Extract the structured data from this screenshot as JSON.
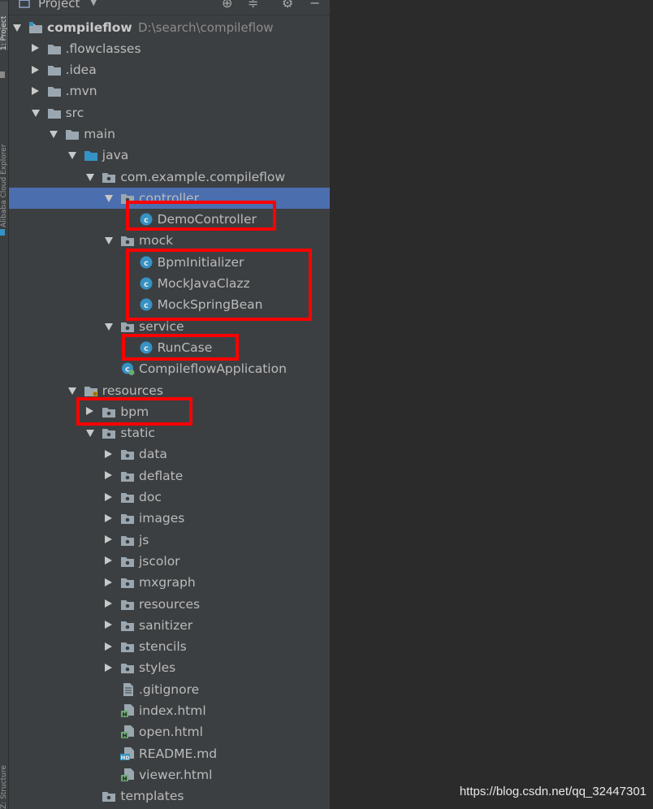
{
  "panel": {
    "title": "Project",
    "toolbar_icons": [
      "crosshair-icon",
      "collapse-icon",
      "gear-icon",
      "minimize-icon"
    ]
  },
  "side_tabs": {
    "project": "1: Project",
    "cloud": "Alibaba Cloud Explorer",
    "structure": "Z: Structure"
  },
  "colors": {
    "background": "#2b2b2b",
    "panel": "#3c3f41",
    "selection": "#4b6eaf",
    "highlight_box": "#ff0000",
    "java_class": "#3592c4"
  },
  "tree": [
    {
      "label": "compileflow",
      "path": "D:\\search\\compileflow",
      "level": 0,
      "expanded": true,
      "icon": "module-folder-icon",
      "bold": true
    },
    {
      "label": ".flowclasses",
      "level": 1,
      "expanded": false,
      "icon": "folder-icon"
    },
    {
      "label": ".idea",
      "level": 1,
      "expanded": false,
      "icon": "folder-icon"
    },
    {
      "label": ".mvn",
      "level": 1,
      "expanded": false,
      "icon": "folder-icon"
    },
    {
      "label": "src",
      "level": 1,
      "expanded": true,
      "icon": "folder-icon"
    },
    {
      "label": "main",
      "level": 2,
      "expanded": true,
      "icon": "folder-icon"
    },
    {
      "label": "java",
      "level": 3,
      "expanded": true,
      "icon": "source-folder-icon"
    },
    {
      "label": "com.example.compileflow",
      "level": 4,
      "expanded": true,
      "icon": "package-icon"
    },
    {
      "label": "controller",
      "level": 5,
      "expanded": true,
      "icon": "package-icon",
      "selected": true
    },
    {
      "label": "DemoController",
      "level": 6,
      "icon": "java-class-icon"
    },
    {
      "label": "mock",
      "level": 5,
      "expanded": true,
      "icon": "package-icon"
    },
    {
      "label": "BpmInitializer",
      "level": 6,
      "icon": "java-class-icon"
    },
    {
      "label": "MockJavaClazz",
      "level": 6,
      "icon": "java-class-icon"
    },
    {
      "label": "MockSpringBean",
      "level": 6,
      "icon": "java-class-icon"
    },
    {
      "label": "service",
      "level": 5,
      "expanded": true,
      "icon": "package-icon"
    },
    {
      "label": "RunCase",
      "level": 6,
      "icon": "java-class-icon"
    },
    {
      "label": "CompileflowApplication",
      "level": 5,
      "icon": "spring-boot-class-icon"
    },
    {
      "label": "resources",
      "level": 3,
      "expanded": true,
      "icon": "resources-folder-icon"
    },
    {
      "label": "bpm",
      "level": 4,
      "expanded": false,
      "icon": "package-icon"
    },
    {
      "label": "static",
      "level": 4,
      "expanded": true,
      "icon": "package-icon"
    },
    {
      "label": "data",
      "level": 5,
      "expanded": false,
      "icon": "package-icon"
    },
    {
      "label": "deflate",
      "level": 5,
      "expanded": false,
      "icon": "package-icon"
    },
    {
      "label": "doc",
      "level": 5,
      "expanded": false,
      "icon": "package-icon"
    },
    {
      "label": "images",
      "level": 5,
      "expanded": false,
      "icon": "package-icon"
    },
    {
      "label": "js",
      "level": 5,
      "expanded": false,
      "icon": "package-icon"
    },
    {
      "label": "jscolor",
      "level": 5,
      "expanded": false,
      "icon": "package-icon"
    },
    {
      "label": "mxgraph",
      "level": 5,
      "expanded": false,
      "icon": "package-icon"
    },
    {
      "label": "resources",
      "level": 5,
      "expanded": false,
      "icon": "package-icon"
    },
    {
      "label": "sanitizer",
      "level": 5,
      "expanded": false,
      "icon": "package-icon"
    },
    {
      "label": "stencils",
      "level": 5,
      "expanded": false,
      "icon": "package-icon"
    },
    {
      "label": "styles",
      "level": 5,
      "expanded": false,
      "icon": "package-icon"
    },
    {
      "label": ".gitignore",
      "level": 5,
      "icon": "text-file-icon"
    },
    {
      "label": "index.html",
      "level": 5,
      "icon": "html-file-icon"
    },
    {
      "label": "open.html",
      "level": 5,
      "icon": "html-file-icon"
    },
    {
      "label": "README.md",
      "level": 5,
      "icon": "markdown-file-icon"
    },
    {
      "label": "viewer.html",
      "level": 5,
      "icon": "html-file-icon"
    },
    {
      "label": "templates",
      "level": 4,
      "icon": "package-icon"
    }
  ],
  "watermark": "https://blog.csdn.net/qq_32447301"
}
